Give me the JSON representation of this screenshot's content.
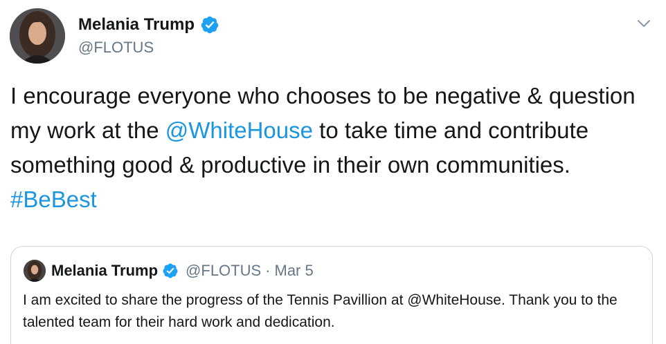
{
  "tweet": {
    "author_name": "Melania Trump",
    "author_handle": "@FLOTUS",
    "text_part1": "I encourage everyone who chooses to be negative & question my work at the ",
    "mention": "@WhiteHouse",
    "text_part2": " to take time and contribute something good & productive in their own communities. ",
    "hashtag": "#BeBest"
  },
  "quoted_tweet": {
    "author_name": "Melania Trump",
    "author_handle": "@FLOTUS",
    "separator": "·",
    "date": "Mar 5",
    "text": "I am excited to share the progress of the Tennis Pavillion at @WhiteHouse. Thank you to the talented team for their hard work and dedication."
  },
  "icons": {
    "verified": "verified-badge-icon",
    "caret": "chevron-down-icon"
  },
  "colors": {
    "link": "#1b95e0",
    "verified": "#1da1f2",
    "secondary_text": "#657786",
    "border": "#ccd6dd"
  }
}
